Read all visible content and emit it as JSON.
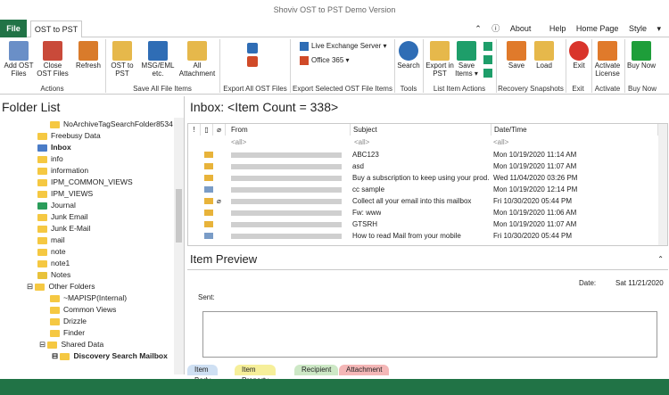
{
  "window": {
    "title": "Shoviv OST to PST Demo Version"
  },
  "tabs": {
    "file": "File",
    "main": "OST to PST"
  },
  "links": {
    "about": "About",
    "help": "Help",
    "home": "Home Page",
    "style": "Style"
  },
  "ribbon": {
    "add_ost": "Add OST Files",
    "close_ost": "Close OST Files",
    "refresh": "Refresh",
    "ost_to_pst": "OST to PST",
    "msg_eml": "MSG/EML etc.",
    "all_attachment": "All Attachment",
    "live_exchange": "Live Exchange Server",
    "office365": "Office 365",
    "search": "Search",
    "export_pst": "Export in PST",
    "save_items": "Save Items",
    "save": "Save",
    "load": "Load",
    "exit": "Exit",
    "activate": "Activate License",
    "buy": "Buy Now",
    "groups": {
      "actions": "Actions",
      "save_all": "Save All File Items",
      "export_all": "Export All OST Files",
      "export_selected": "Export Selected OST File Items",
      "tools": "Tools",
      "list_actions": "List Item Actions",
      "recovery": "Recovery Snapshots",
      "exit": "Exit",
      "activate": "Activate",
      "buy": "Buy Now"
    }
  },
  "folders": {
    "title": "Folder List",
    "items": [
      {
        "label": "NoArchiveTagSearchFolder8534"
      },
      {
        "label": "Freebusy Data"
      },
      {
        "label": "Inbox"
      },
      {
        "label": "info"
      },
      {
        "label": "information"
      },
      {
        "label": "IPM_COMMON_VIEWS"
      },
      {
        "label": "IPM_VIEWS"
      },
      {
        "label": "Journal"
      },
      {
        "label": "Junk Email"
      },
      {
        "label": "Junk E-Mail"
      },
      {
        "label": "mail"
      },
      {
        "label": "note"
      },
      {
        "label": "note1"
      },
      {
        "label": "Notes"
      },
      {
        "label": "Other Folders"
      },
      {
        "label": "~MAPISP(Internal)"
      },
      {
        "label": "Common Views"
      },
      {
        "label": "Drizzle"
      },
      {
        "label": "Finder"
      },
      {
        "label": "Shared Data"
      },
      {
        "label": "Discovery Search Mailbox"
      }
    ]
  },
  "list": {
    "title": "Inbox: <Item Count = 338>",
    "col_from": "From",
    "col_subject": "Subject",
    "col_date": "Date/Time",
    "filter": "<all>",
    "rows": [
      {
        "subject": "ABC123",
        "date": "Mon 10/19/2020 11:14 AM"
      },
      {
        "subject": "asd",
        "date": "Mon 10/19/2020 11:07 AM"
      },
      {
        "subject": "Buy a subscription to keep using your prod...",
        "date": "Wed 11/04/2020 03:26 PM"
      },
      {
        "subject": "cc sample",
        "date": "Mon 10/19/2020 12:14 PM"
      },
      {
        "subject": "Collect all your email into this mailbox",
        "date": "Fri 10/30/2020 05:44 PM"
      },
      {
        "subject": "Fw: www",
        "date": "Mon 10/19/2020 11:06 AM"
      },
      {
        "subject": "GTSRH",
        "date": "Mon 10/19/2020 11:07 AM"
      },
      {
        "subject": "How to read Mail from your mobile",
        "date": "Fri 10/30/2020 05:44 PM"
      }
    ]
  },
  "preview": {
    "title": "Item Preview",
    "date_label": "Date:",
    "date_value": "Sat 11/21/2020",
    "sent_label": "Sent:"
  },
  "bottom_tabs": {
    "body": "Item Body",
    "property": "Item Property",
    "recipient": "Recipient",
    "attachment": "Attachment"
  }
}
